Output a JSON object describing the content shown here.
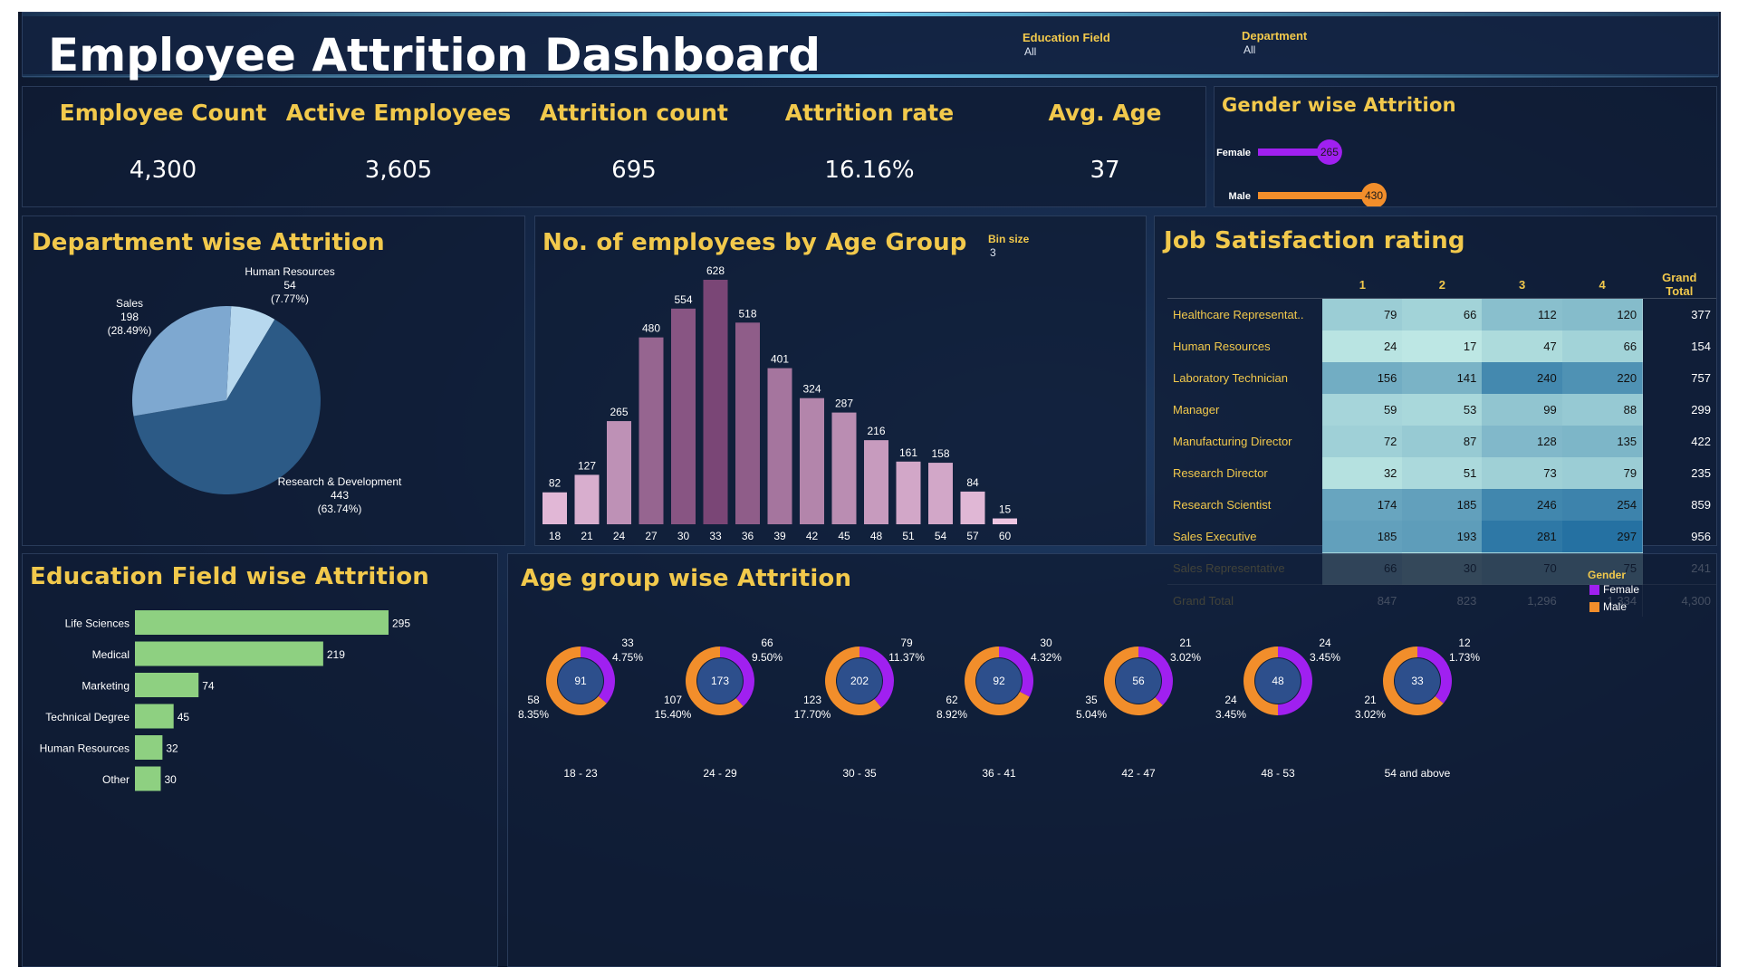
{
  "header": {
    "title": "Employee Attrition Dashboard",
    "filters": [
      {
        "label": "Education Field",
        "value": "All"
      },
      {
        "label": "Department",
        "value": "All"
      }
    ]
  },
  "kpis": [
    {
      "label": "Employee Count",
      "value": "4,300"
    },
    {
      "label": "Active Employees",
      "value": "3,605"
    },
    {
      "label": "Attrition count",
      "value": "695"
    },
    {
      "label": "Attrition rate",
      "value": "16.16%"
    },
    {
      "label": "Avg. Age",
      "value": "37"
    }
  ],
  "gender_attrition": {
    "title": "Gender wise Attrition",
    "rows": [
      {
        "label": "Female",
        "value": 265,
        "color": "#a020f0"
      },
      {
        "label": "Male",
        "value": 430,
        "color": "#f28e2b"
      }
    ]
  },
  "department_attrition": {
    "title": "Department wise Attrition",
    "slices": [
      {
        "name": "Human Resources",
        "value": 54,
        "pct": "(7.77%)",
        "value_label": "54",
        "color": "#b7d8ee"
      },
      {
        "name": "Research & Development",
        "value": 443,
        "pct": "(63.74%)",
        "value_label": "443",
        "color": "#2c5a86"
      },
      {
        "name": "Sales",
        "value": 198,
        "pct": "(28.49%)",
        "value_label": "198",
        "color": "#7ea8d0"
      }
    ]
  },
  "age_histogram": {
    "title": "No. of employees by Age Group",
    "bin_label": "Bin size",
    "bin_value": "3",
    "categories": [
      "18",
      "21",
      "24",
      "27",
      "30",
      "33",
      "36",
      "39",
      "42",
      "45",
      "48",
      "51",
      "54",
      "57",
      "60"
    ],
    "values": [
      82,
      127,
      265,
      480,
      554,
      628,
      518,
      401,
      324,
      287,
      216,
      161,
      158,
      84,
      15
    ]
  },
  "job_satisfaction": {
    "title": "Job Satisfaction rating",
    "columns": [
      "1",
      "2",
      "3",
      "4",
      "Grand Total"
    ],
    "rows": [
      {
        "label": "Healthcare Representat..",
        "values": [
          "79",
          "66",
          "112",
          "120"
        ],
        "total": "377"
      },
      {
        "label": "Human Resources",
        "values": [
          "24",
          "17",
          "47",
          "66"
        ],
        "total": "154"
      },
      {
        "label": "Laboratory Technician",
        "values": [
          "156",
          "141",
          "240",
          "220"
        ],
        "total": "757"
      },
      {
        "label": "Manager",
        "values": [
          "59",
          "53",
          "99",
          "88"
        ],
        "total": "299"
      },
      {
        "label": "Manufacturing Director",
        "values": [
          "72",
          "87",
          "128",
          "135"
        ],
        "total": "422"
      },
      {
        "label": "Research Director",
        "values": [
          "32",
          "51",
          "73",
          "79"
        ],
        "total": "235"
      },
      {
        "label": "Research Scientist",
        "values": [
          "174",
          "185",
          "246",
          "254"
        ],
        "total": "859"
      },
      {
        "label": "Sales Executive",
        "values": [
          "185",
          "193",
          "281",
          "297"
        ],
        "total": "956"
      },
      {
        "label": "Sales Representative",
        "values": [
          "66",
          "30",
          "70",
          "75"
        ],
        "total": "241"
      }
    ],
    "grand_total": {
      "label": "Grand Total",
      "values": [
        "847",
        "823",
        "1,296",
        "1,334"
      ],
      "total": "4,300"
    }
  },
  "education_attrition": {
    "title": "Education Field wise Attrition",
    "categories": [
      "Life Sciences",
      "Medical",
      "Marketing",
      "Technical Degree",
      "Human Resources",
      "Other"
    ],
    "values": [
      295,
      219,
      74,
      45,
      32,
      30
    ],
    "color": "#8ed081"
  },
  "age_group_attrition": {
    "title": "Age group wise Attrition",
    "legend_title": "Gender",
    "legend": [
      {
        "label": "Female",
        "color": "#a020f0"
      },
      {
        "label": "Male",
        "color": "#f28e2b"
      }
    ],
    "groups": [
      {
        "label": "18 - 23",
        "total": "91",
        "female": 33,
        "female_pct": "4.75%",
        "male": 58,
        "male_pct": "8.35%"
      },
      {
        "label": "24 - 29",
        "total": "173",
        "female": 66,
        "female_pct": "9.50%",
        "male": 107,
        "male_pct": "15.40%"
      },
      {
        "label": "30 - 35",
        "total": "202",
        "female": 79,
        "female_pct": "11.37%",
        "male": 123,
        "male_pct": "17.70%"
      },
      {
        "label": "36 - 41",
        "total": "92",
        "female": 30,
        "female_pct": "4.32%",
        "male": 62,
        "male_pct": "8.92%"
      },
      {
        "label": "42 - 47",
        "total": "56",
        "female": 21,
        "female_pct": "3.02%",
        "male": 35,
        "male_pct": "5.04%"
      },
      {
        "label": "48 - 53",
        "total": "48",
        "female": 24,
        "female_pct": "3.45%",
        "male": 24,
        "male_pct": "3.45%"
      },
      {
        "label": "54 and above",
        "total": "33",
        "female": 12,
        "female_pct": "1.73%",
        "male": 21,
        "male_pct": "3.02%"
      }
    ]
  },
  "chart_data": [
    {
      "type": "bar",
      "title": "No. of employees by Age Group",
      "categories": [
        "18",
        "21",
        "24",
        "27",
        "30",
        "33",
        "36",
        "39",
        "42",
        "45",
        "48",
        "51",
        "54",
        "57",
        "60"
      ],
      "values": [
        82,
        127,
        265,
        480,
        554,
        628,
        518,
        401,
        324,
        287,
        216,
        161,
        158,
        84,
        15
      ]
    },
    {
      "type": "pie",
      "title": "Department wise Attrition",
      "categories": [
        "Human Resources",
        "Research & Development",
        "Sales"
      ],
      "values": [
        54,
        443,
        198
      ]
    },
    {
      "type": "bar",
      "title": "Education Field wise Attrition",
      "categories": [
        "Life Sciences",
        "Medical",
        "Marketing",
        "Technical Degree",
        "Human Resources",
        "Other"
      ],
      "values": [
        295,
        219,
        74,
        45,
        32,
        30
      ]
    },
    {
      "type": "bar",
      "title": "Gender wise Attrition",
      "categories": [
        "Female",
        "Male"
      ],
      "values": [
        265,
        430
      ]
    },
    {
      "type": "table",
      "title": "Job Satisfaction rating",
      "columns": [
        "1",
        "2",
        "3",
        "4",
        "Grand Total"
      ]
    },
    {
      "type": "pie",
      "title": "Age group wise Attrition",
      "categories": [
        "18 - 23",
        "24 - 29",
        "30 - 35",
        "36 - 41",
        "42 - 47",
        "48 - 53",
        "54 and above"
      ],
      "series": [
        {
          "name": "Female",
          "values": [
            33,
            66,
            79,
            30,
            21,
            24,
            12
          ]
        },
        {
          "name": "Male",
          "values": [
            58,
            107,
            123,
            62,
            35,
            24,
            21
          ]
        }
      ]
    }
  ]
}
